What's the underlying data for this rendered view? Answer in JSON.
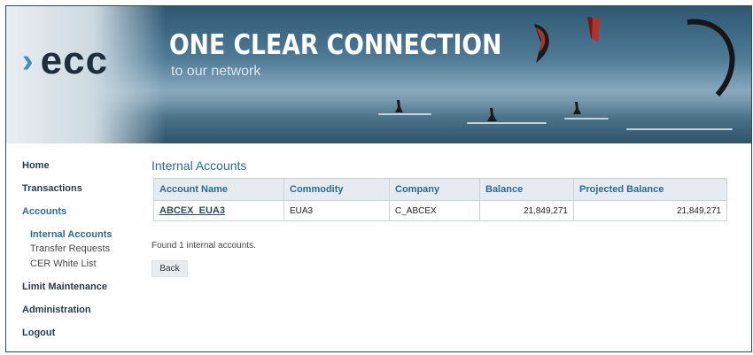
{
  "brand": {
    "logo_text": "ecc",
    "logo_chevron": "›",
    "tagline_main": "ONE CLEAR CONNECTION",
    "tagline_sub": "to our network"
  },
  "sidebar": {
    "items": [
      {
        "label": "Home"
      },
      {
        "label": "Transactions"
      },
      {
        "label": "Accounts"
      },
      {
        "label": "Internal Accounts"
      },
      {
        "label": "Transfer Requests"
      },
      {
        "label": "CER White List"
      },
      {
        "label": "Limit Maintenance"
      },
      {
        "label": "Administration"
      },
      {
        "label": "Logout"
      }
    ]
  },
  "main": {
    "title": "Internal Accounts",
    "table": {
      "headers": [
        "Account Name",
        "Commodity",
        "Company",
        "Balance",
        "Projected Balance"
      ],
      "rows": [
        {
          "account_name": "ABCEX_EUA3",
          "commodity": "EUA3",
          "company": "C_ABCEX",
          "balance": "21,849,271",
          "projected_balance": "21,849,271"
        }
      ]
    },
    "result_text": "Found 1 internal accounts.",
    "back_label": "Back"
  },
  "colors": {
    "accent": "#2d6a92",
    "banner": "#3a6179",
    "logo_chevron": "#3a8fc4"
  },
  "icons": {
    "kites": "kite-shapes"
  }
}
